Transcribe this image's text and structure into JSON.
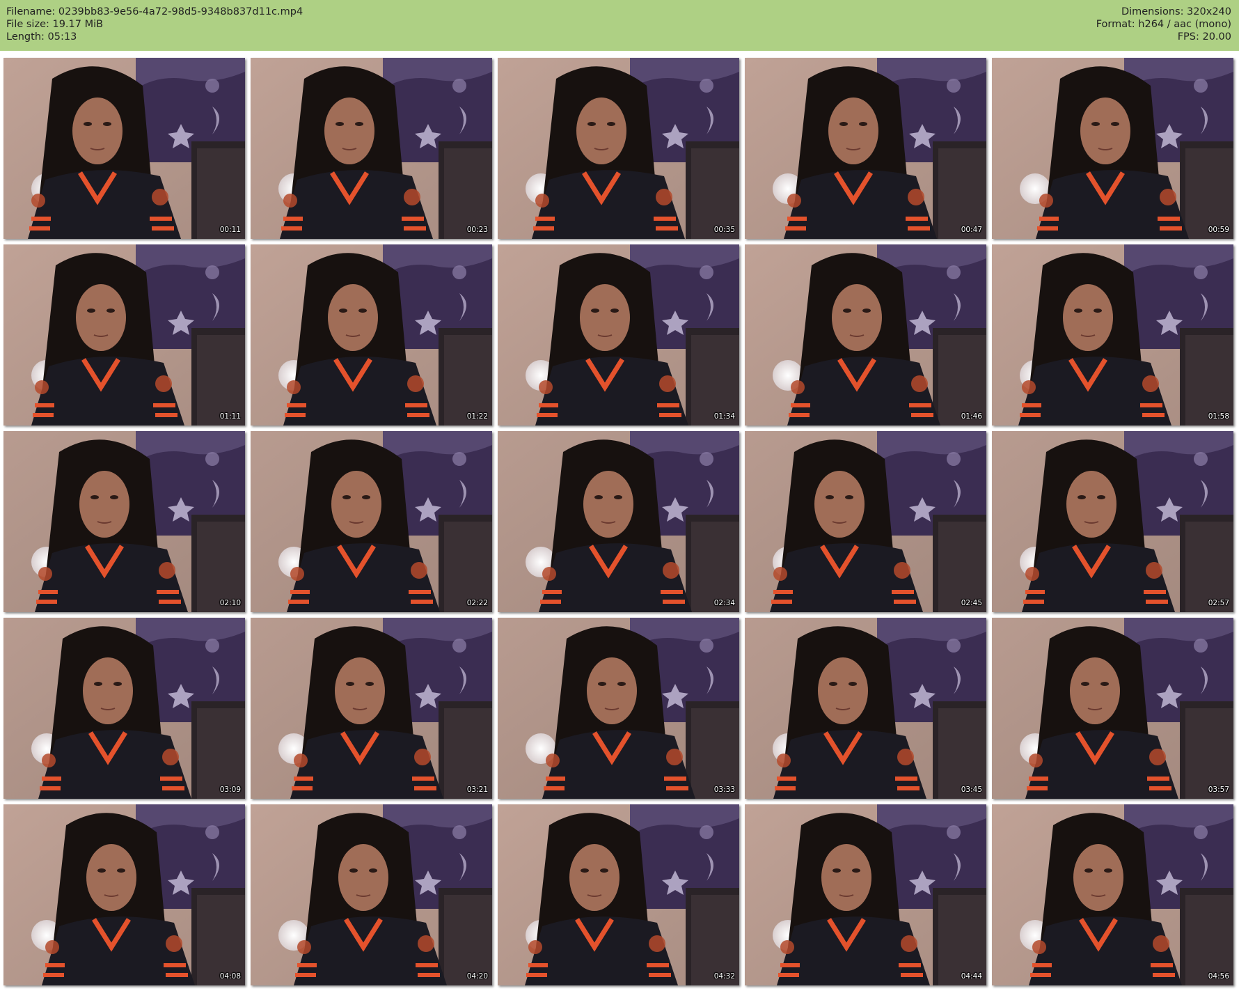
{
  "header": {
    "filename": "Filename: 0239bb83-9e56-4a72-98d5-9348b837d11c.mp4",
    "file_size": "File size: 19.17 MiB",
    "length": "Length: 05:13",
    "dimensions": "Dimensions: 320x240",
    "format": "Format: h264 / aac (mono)",
    "fps": "FPS: 20.00"
  },
  "colors": {
    "header_bg": "#aed084",
    "wall": "#a88d82",
    "tapestry": "#3b2d52",
    "jersey": "#1b1a22",
    "stripe": "#e4522c",
    "hair": "#17110f",
    "skin": "#a06d57"
  },
  "thumbnails": [
    {
      "time": "00:11"
    },
    {
      "time": "00:23"
    },
    {
      "time": "00:35"
    },
    {
      "time": "00:47"
    },
    {
      "time": "00:59"
    },
    {
      "time": "01:11"
    },
    {
      "time": "01:22"
    },
    {
      "time": "01:34"
    },
    {
      "time": "01:46"
    },
    {
      "time": "01:58"
    },
    {
      "time": "02:10"
    },
    {
      "time": "02:22"
    },
    {
      "time": "02:34"
    },
    {
      "time": "02:45"
    },
    {
      "time": "02:57"
    },
    {
      "time": "03:09"
    },
    {
      "time": "03:21"
    },
    {
      "time": "03:33"
    },
    {
      "time": "03:45"
    },
    {
      "time": "03:57"
    },
    {
      "time": "04:08"
    },
    {
      "time": "04:20"
    },
    {
      "time": "04:32"
    },
    {
      "time": "04:44"
    },
    {
      "time": "04:56"
    }
  ]
}
